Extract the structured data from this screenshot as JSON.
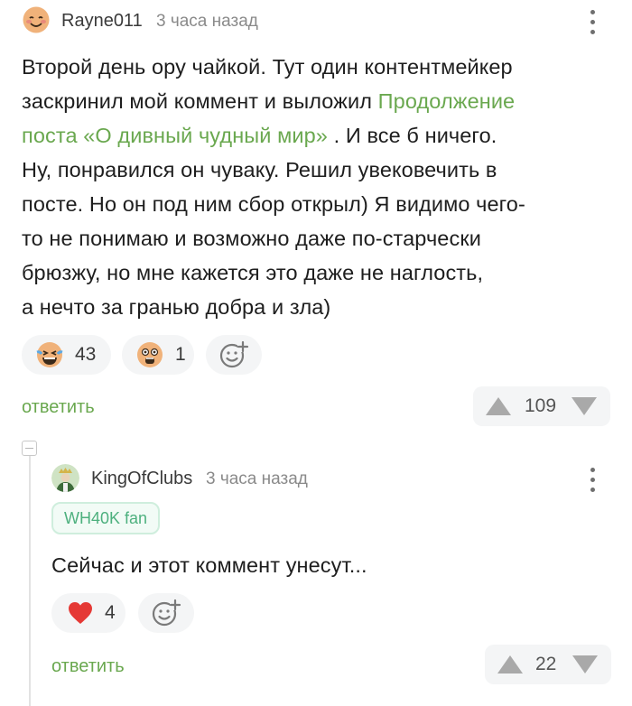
{
  "comment": {
    "author": "Rayne011",
    "time": "3 часа назад",
    "lines": {
      "l1": "Второй день ору чайкой. Тут один контентмейкер",
      "l2_pre": "заскринил мой коммент и выложил ",
      "l2_link": "Продолжение",
      "l3_link": "поста «О дивный чудный мир»",
      "l3_post": " . И все б ничего.",
      "l4": "Ну, понравился он чуваку. Решил увековечить в",
      "l5": "посте. Но он под ним сбор открыл) Я видимо чего-",
      "l6": "то не понимаю и возможно даже по-старчески",
      "l7": "брюзжу, но мне кажется это даже не наглость,",
      "l8": "а нечто за гранью добра и зла)"
    },
    "reactions": [
      {
        "icon": "laughing-emoji-icon",
        "count": "43"
      },
      {
        "icon": "scared-emoji-icon",
        "count": "1"
      }
    ],
    "reply_label": "ответить",
    "rating": "109"
  },
  "reply_comment": {
    "author": "KingOfClubs",
    "time": "3 часа назад",
    "badge": "WH40K fan",
    "text": "Сейчас и этот коммент унесут...",
    "reactions": [
      {
        "icon": "heart-icon",
        "count": "4"
      }
    ],
    "reply_label": "ответить",
    "rating": "22"
  },
  "colors": {
    "link": "#6aa84f",
    "badge_text": "#4db07e",
    "heart": "#e53935"
  }
}
